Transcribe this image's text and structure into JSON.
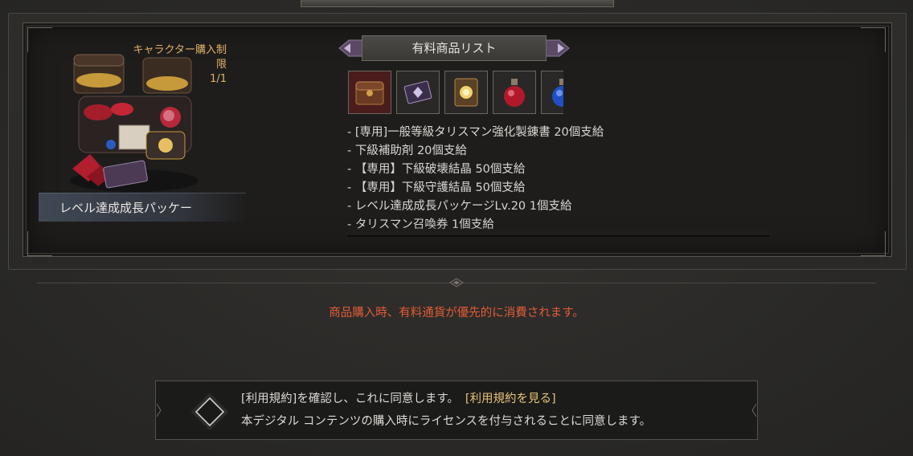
{
  "product": {
    "purchase_limit_label_1": "キャラクター購入制",
    "purchase_limit_label_2": "限",
    "purchase_limit_count": "1/1",
    "name": "レベル達成成長パッケー"
  },
  "paid_list": {
    "title": "有料商品リスト",
    "item_icons": [
      "treasure-chest-icon",
      "talisman-card-icon",
      "scroll-icon",
      "red-potion-icon",
      "blue-potion-icon"
    ],
    "rewards": [
      "- [専用]一般等級タリスマン強化製錬書 20個支給",
      "- 下級補助剤 20個支給",
      "- 【専用】下級破壊結晶 50個支給",
      "- 【専用】下級守護結晶 50個支給",
      "- レベル達成成長パッケージLv.20 1個支給",
      "- タリスマン召喚券 1個支給"
    ]
  },
  "notice": "商品購入時、有料通貨が優先的に消費されます。",
  "terms": {
    "line1": "[利用規約]を確認し、これに同意します。",
    "link": "[利用規約を見る]",
    "line2": "本デジタル コンテンツの購入時にライセンスを付与されることに同意します。"
  },
  "colors": {
    "accent_gold": "#e3b06b",
    "notice_red": "#e15b36",
    "link_gold": "#e8c27a"
  }
}
